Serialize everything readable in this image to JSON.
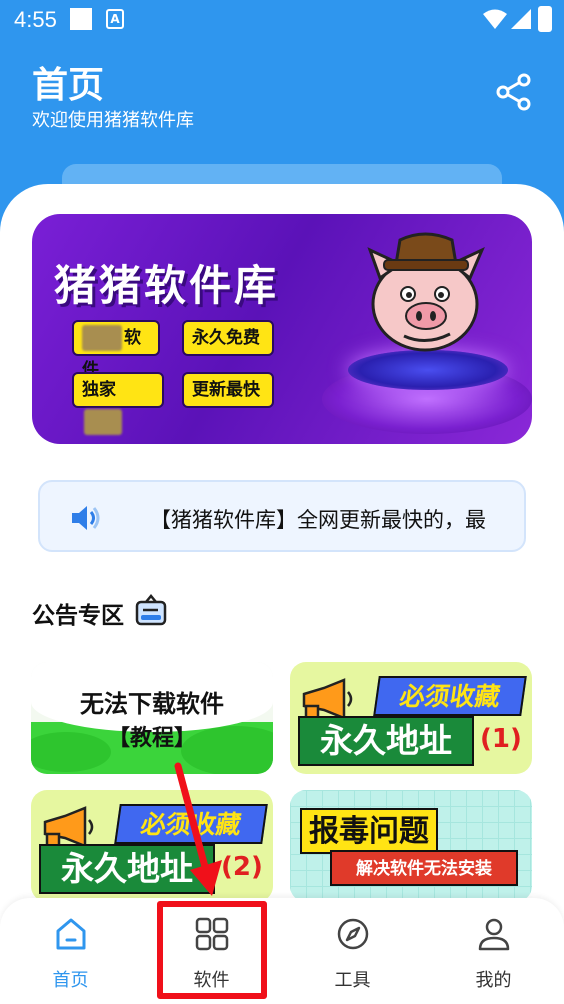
{
  "status_bar": {
    "time": "4:55",
    "notif_letter": "A"
  },
  "header": {
    "title": "首页",
    "subtitle": "欢迎使用猪猪软件库"
  },
  "banner": {
    "title": "猪猪软件库",
    "tags": [
      "软件",
      "永久免费",
      "独家",
      "更新最快"
    ]
  },
  "notice": {
    "text": "【猪猪软件库】全网更新最快的，最"
  },
  "section": {
    "title": "公告专区"
  },
  "cards": {
    "card1": {
      "line1": "无法下载软件",
      "line2": "【教程】"
    },
    "card2": {
      "top": "必须收藏",
      "main": "永久地址",
      "num": "(1)"
    },
    "card3": {
      "top": "必须收藏",
      "main": "永久地址",
      "num": "(2)"
    },
    "card4": {
      "main": "报毒问题",
      "sub": "解决软件无法安装"
    }
  },
  "bottom_nav": {
    "active": "home",
    "items": [
      {
        "id": "home",
        "label": "首页",
        "icon": "home-icon"
      },
      {
        "id": "software",
        "label": "软件",
        "icon": "grid-icon"
      },
      {
        "id": "tools",
        "label": "工具",
        "icon": "compass-icon"
      },
      {
        "id": "mine",
        "label": "我的",
        "icon": "user-icon"
      }
    ]
  },
  "colors": {
    "primary": "#2f96ee",
    "annotation_red": "#f0101a",
    "banner_purple": "#6a18c8"
  }
}
